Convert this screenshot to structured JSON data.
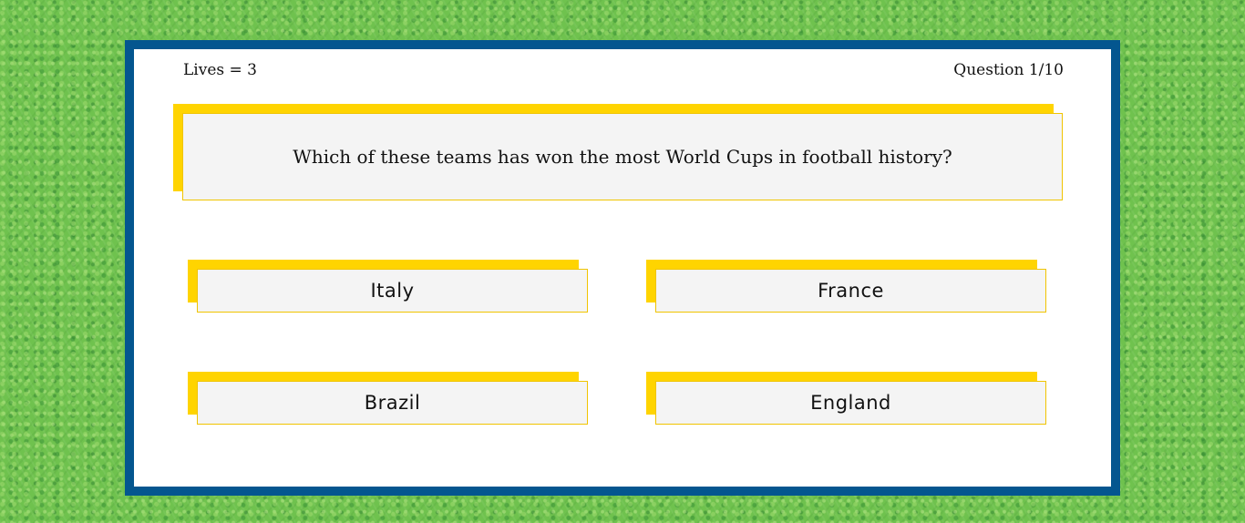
{
  "status": {
    "lives": "Lives = 3",
    "question_counter": "Question 1/10"
  },
  "question": {
    "text": "Which of these teams has won the most World Cups in football history?"
  },
  "answers": [
    {
      "label": "Italy"
    },
    {
      "label": "France"
    },
    {
      "label": "Brazil"
    },
    {
      "label": "England"
    }
  ],
  "colors": {
    "frame_border": "#04568f",
    "accent_yellow": "#ffd400",
    "panel_bg": "#f4f4f4",
    "grass": "#6fc24e"
  }
}
